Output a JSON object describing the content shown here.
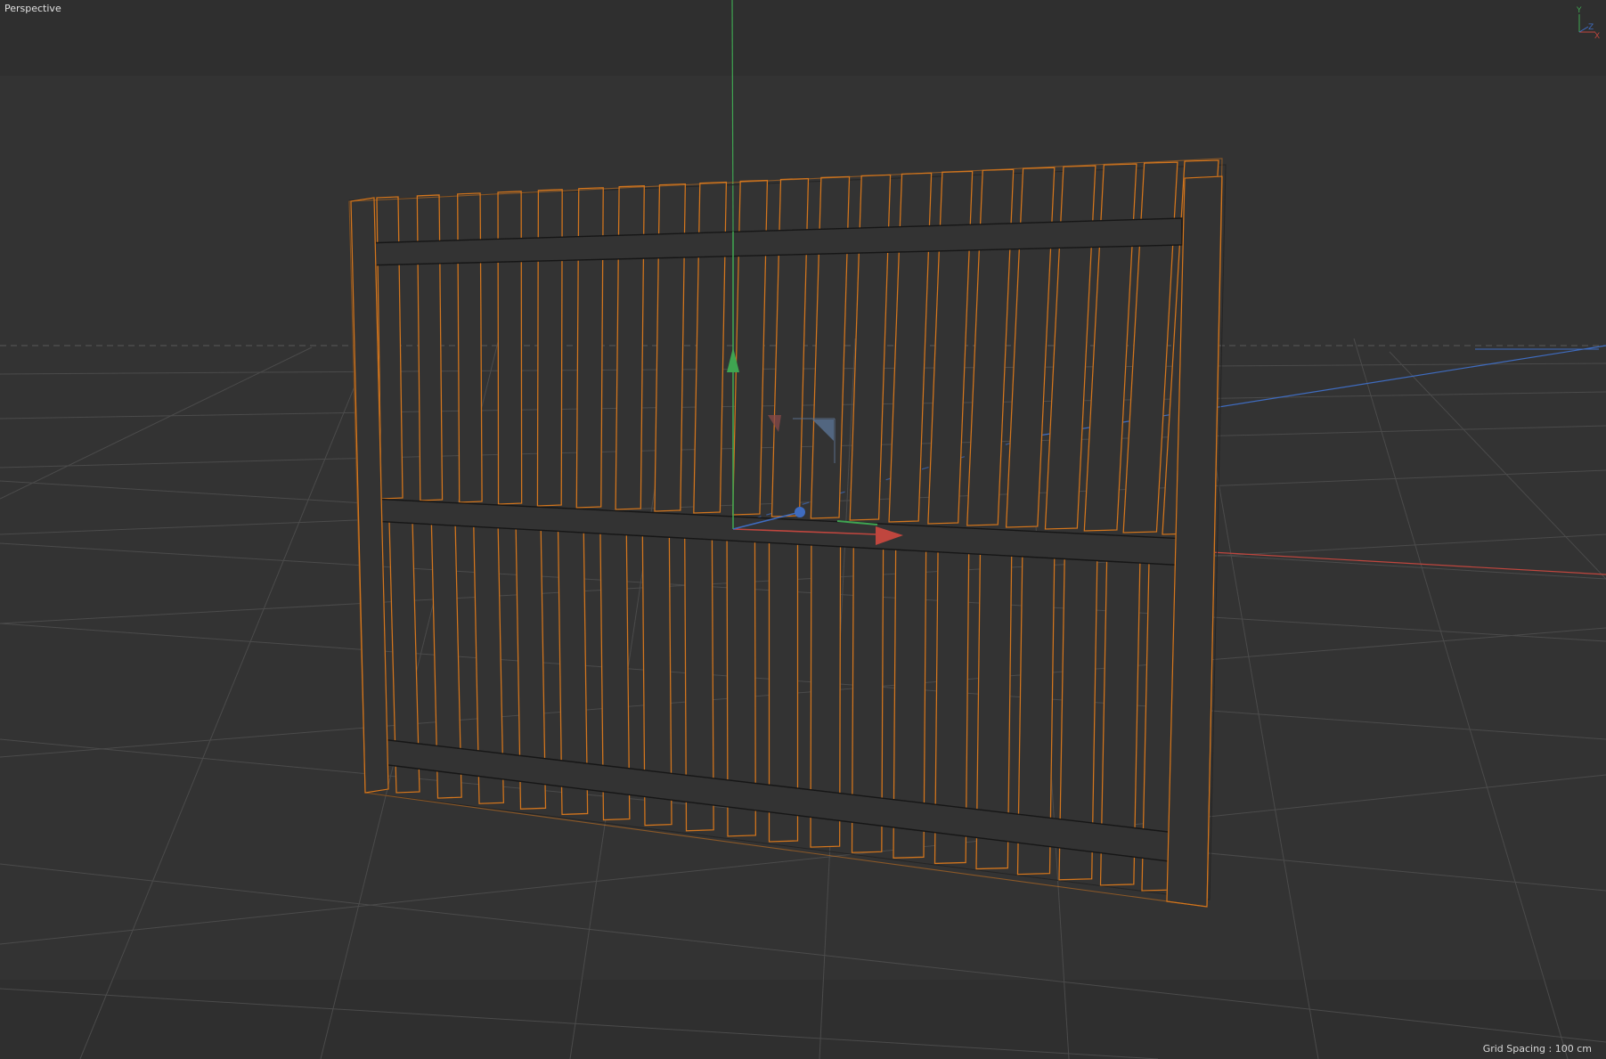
{
  "viewport": {
    "label": "Perspective",
    "grid_spacing": "Grid Spacing : 100 cm",
    "camera_axes": {
      "y": "Y",
      "z": "Z",
      "x": "X"
    },
    "colors": {
      "background": "#333333",
      "grid": "#4b4b4b",
      "selection_outline": "#d2761f",
      "wire": "#161616",
      "axis_x": "#c0463e",
      "axis_y": "#3fa451",
      "axis_z": "#3f6cc0"
    }
  },
  "scene": {
    "object": "fence",
    "selected": true,
    "upper_pickets": 21,
    "lower_pickets": 19
  }
}
